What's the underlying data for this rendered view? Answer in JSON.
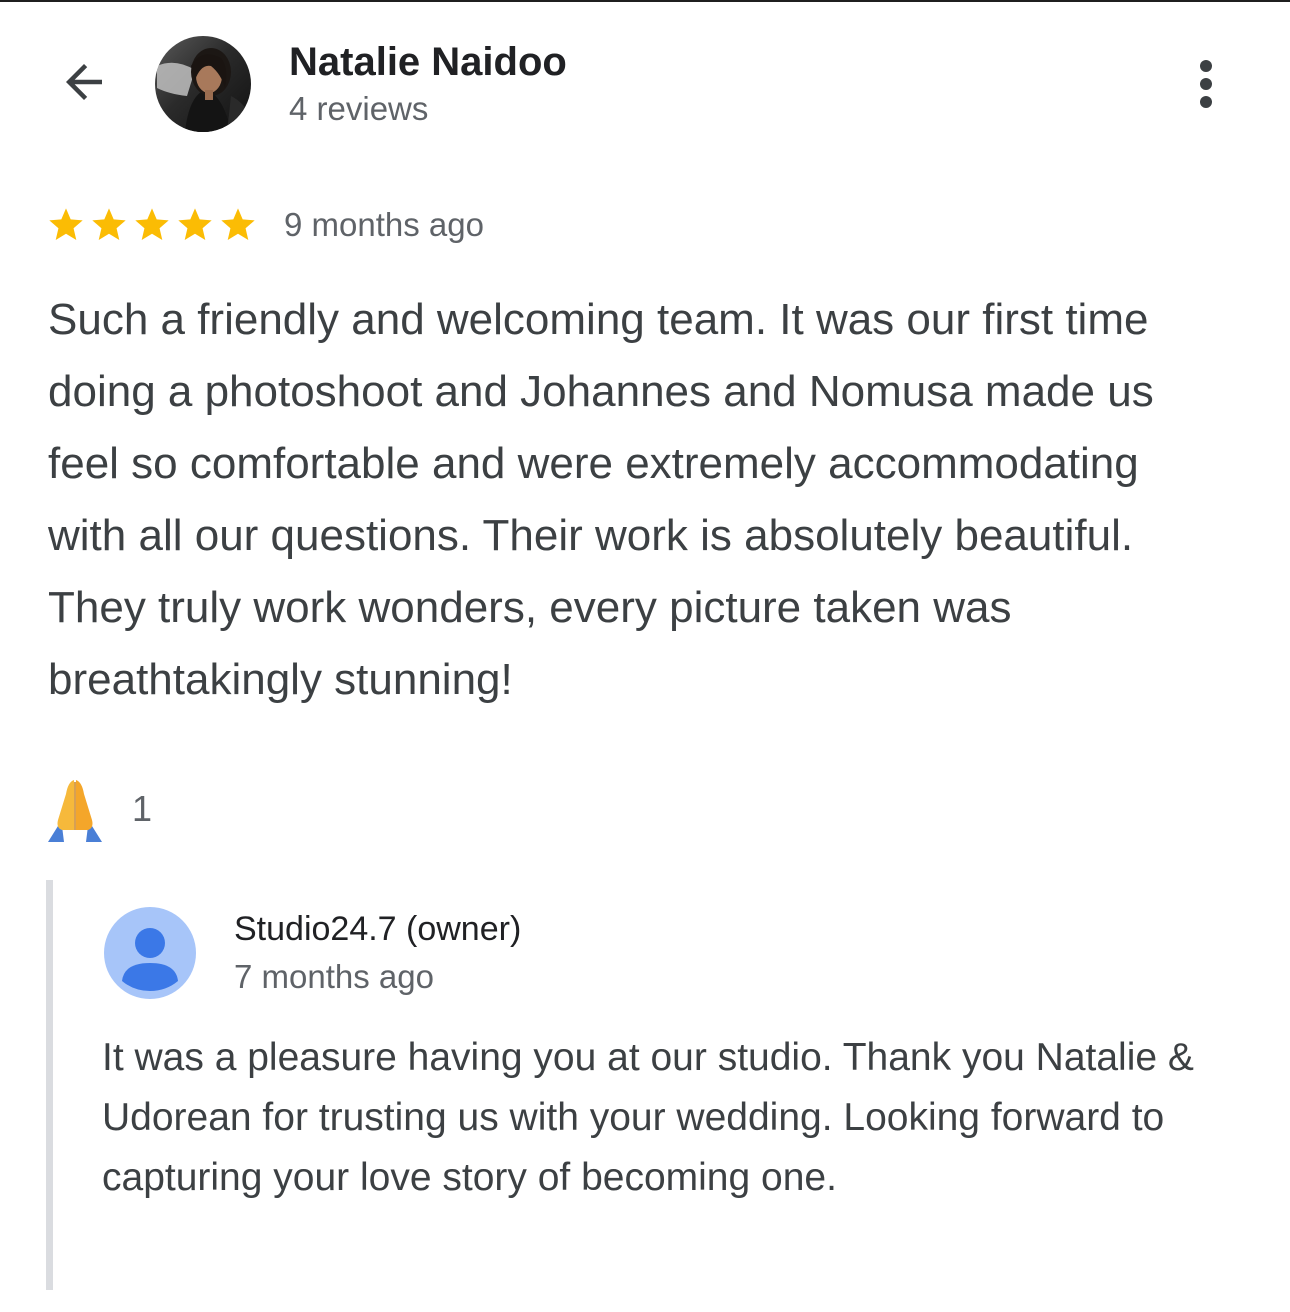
{
  "header": {
    "back_icon": "arrow-left-icon",
    "reviewer_name": "Natalie Naidoo",
    "review_count": "4 reviews",
    "more_icon": "more-vert-icon"
  },
  "review": {
    "rating": 5,
    "rating_max": 5,
    "star_color": "#fbbc04",
    "date": "9 months ago",
    "text": "Such a friendly and welcoming team. It was our first time doing a photoshoot and Johannes and Nomusa made us feel so comfortable and were extremely accommodating with all our questions. Their work is absolutely beautiful. They truly work wonders, every picture taken was breathtakingly stunning!"
  },
  "reaction": {
    "icon": "folded-hands-emoji",
    "count": "1"
  },
  "owner_reply": {
    "avatar_icon": "default-person-avatar-icon",
    "name": "Studio24.7 (owner)",
    "date": "7 months ago",
    "text": "It was a pleasure having you at our studio. Thank you Natalie & Udorean for trusting us with your wedding. Looking forward to capturing your love story of becoming one."
  }
}
